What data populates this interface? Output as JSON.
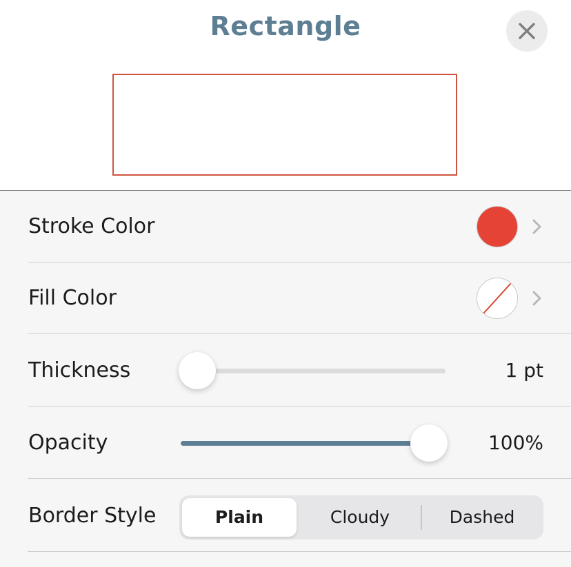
{
  "header": {
    "title": "Rectangle",
    "close_icon": "close-icon"
  },
  "colors": {
    "title": "#5e7f93",
    "accent": "#5e7f93",
    "stroke_color": "#e54335",
    "preview_border": "#cf5440"
  },
  "rows": {
    "stroke_color": {
      "label": "Stroke Color",
      "swatch": "#e54335",
      "icon": "chevron-right-icon"
    },
    "fill_color": {
      "label": "Fill Color",
      "swatch": "none",
      "icon": "chevron-right-icon"
    },
    "thickness": {
      "label": "Thickness",
      "value_text": "1 pt",
      "level": 0.0
    },
    "opacity": {
      "label": "Opacity",
      "value_text": "100%",
      "level": 1.0
    },
    "border_style": {
      "label": "Border Style",
      "options": [
        "Plain",
        "Cloudy",
        "Dashed"
      ],
      "selected": "Plain"
    }
  }
}
